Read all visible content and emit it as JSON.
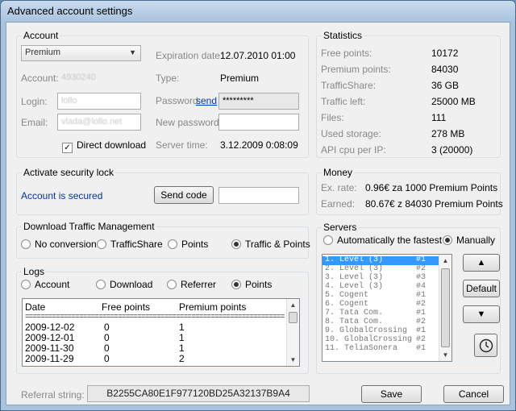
{
  "window": {
    "title": "Advanced account settings"
  },
  "account": {
    "group_label": "Account",
    "type_select": "Premium",
    "account_label": "Account:",
    "account_value": "4930240",
    "login_label": "Login:",
    "login_value": "lollo",
    "email_label": "Email:",
    "email_value": "vlada@lollo.net",
    "direct_download_label": "Direct download",
    "expiration_label": "Expiration date:",
    "expiration_value": "12.07.2010 01:00",
    "type_label": "Type:",
    "type_value": "Premium",
    "password_label": "Password:",
    "password_send_link": "send",
    "password_value": "*********",
    "new_password_label": "New password:",
    "new_password_value": "",
    "server_time_label": "Server time:",
    "server_time_value": "3.12.2009 0:08:09"
  },
  "statistics": {
    "group_label": "Statistics",
    "rows": [
      {
        "label": "Free points:",
        "value": "10172"
      },
      {
        "label": "Premium points:",
        "value": "84030"
      },
      {
        "label": "TrafficShare:",
        "value": "36 GB"
      },
      {
        "label": "Traffic left:",
        "value": "25000 MB"
      },
      {
        "label": "Files:",
        "value": "111"
      },
      {
        "label": "Used storage:",
        "value": "278 MB"
      },
      {
        "label": "API cpu per IP:",
        "value": "3 (20000)"
      }
    ]
  },
  "security": {
    "group_label": "Activate security lock",
    "status": "Account is secured",
    "send_code_button": "Send code",
    "code_value": ""
  },
  "money": {
    "group_label": "Money",
    "rate_label": "Ex. rate:",
    "rate_value": "0.96€ za 1000 Premium Points",
    "earned_label": "Earned:",
    "earned_value": "80.67€ z 84030 Premium Points"
  },
  "traffic": {
    "group_label": "Download Traffic Management",
    "options": [
      "No conversion",
      "TrafficShare",
      "Points",
      "Traffic & Points"
    ]
  },
  "servers": {
    "group_label": "Servers",
    "auto_label": "Automatically the fastest",
    "manual_label": "Manually",
    "items": [
      {
        "name": "1. Level (3)",
        "code": "#1"
      },
      {
        "name": "2. Level (3)",
        "code": "#2"
      },
      {
        "name": "3. Level (3)",
        "code": "#3"
      },
      {
        "name": "4. Level (3)",
        "code": "#4"
      },
      {
        "name": "5. Cogent",
        "code": "#1"
      },
      {
        "name": "6. Cogent",
        "code": "#2"
      },
      {
        "name": "7. Tata Com.",
        "code": "#1"
      },
      {
        "name": "8. Tata Com.",
        "code": "#2"
      },
      {
        "name": "9. GlobalCrossing",
        "code": "#1"
      },
      {
        "name": "10. GlobalCrossing",
        "code": "#2"
      },
      {
        "name": "11. TeliaSonera",
        "code": "#1"
      }
    ],
    "up_arrow": "▲",
    "default_button": "Default",
    "down_arrow": "▼"
  },
  "logs": {
    "group_label": "Logs",
    "options": [
      "Account",
      "Download",
      "Referrer",
      "Points"
    ],
    "headers": [
      "Date",
      "Free points",
      "Premium points"
    ],
    "separator": "========================================================================",
    "rows": [
      {
        "date": "2009-12-02",
        "free": "0",
        "premium": "1"
      },
      {
        "date": "2009-12-01",
        "free": "0",
        "premium": "1"
      },
      {
        "date": "2009-11-30",
        "free": "0",
        "premium": "1"
      },
      {
        "date": "2009-11-29",
        "free": "0",
        "premium": "2"
      }
    ]
  },
  "footer": {
    "referral_label": "Referral string:",
    "referral_value": "B2255CA80E1F977120BD25A32137B9A4",
    "save_button": "Save",
    "cancel_button": "Cancel"
  }
}
